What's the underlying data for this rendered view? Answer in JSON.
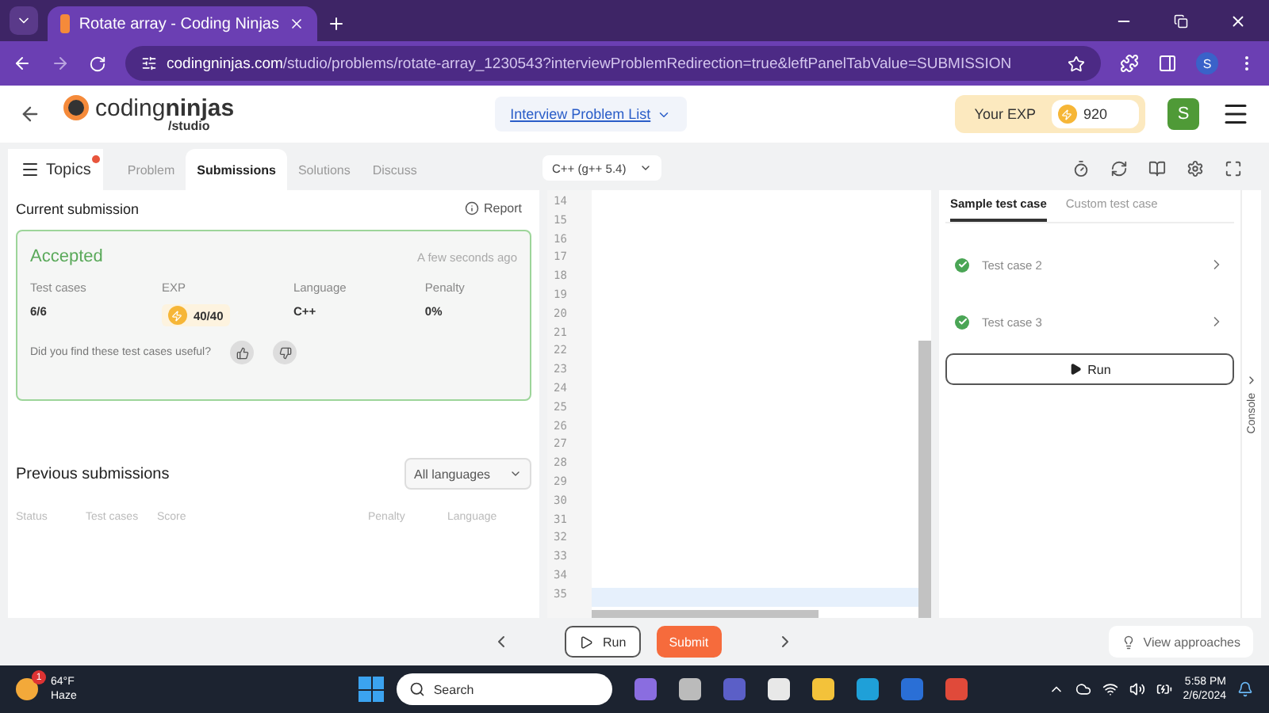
{
  "browser": {
    "tab_title": "Rotate array - Coding Ninjas",
    "url_host": "codingninjas.com",
    "url_path": "/studio/problems/rotate-array_1230543?interviewProblemRedirection=true&leftPanelTabValue=SUBMISSION",
    "profile": "S"
  },
  "header": {
    "logo_word_1": "coding",
    "logo_word_2": "ninjas",
    "logo_sub": "/studio",
    "nav_link": "Interview Problem List",
    "exp_label": "Your EXP",
    "exp_value": "920",
    "avatar": "S"
  },
  "left_tabs": {
    "topics": "Topics",
    "items": [
      {
        "label": "Problem",
        "selected": false
      },
      {
        "label": "Submissions",
        "selected": true
      },
      {
        "label": "Solutions",
        "selected": false
      },
      {
        "label": "Discuss",
        "selected": false
      }
    ]
  },
  "current_submission": {
    "title": "Current submission",
    "report": "Report",
    "status": "Accepted",
    "time": "A few seconds ago",
    "stats": [
      {
        "kind": "plain",
        "label": "Test cases",
        "value": "6/6"
      },
      {
        "kind": "exp",
        "label": "EXP",
        "value": "40/40"
      },
      {
        "kind": "plain",
        "label": "Language",
        "value": "C++"
      },
      {
        "kind": "plain",
        "label": "Penalty",
        "value": "0%"
      }
    ],
    "feedback": "Did you find these test cases useful?"
  },
  "previous_submissions": {
    "title": "Previous submissions",
    "filter": "All languages",
    "columns": [
      "Status",
      "Test cases",
      "Score",
      "Penalty",
      "Language"
    ]
  },
  "editor": {
    "language": "C++ (g++ 5.4)",
    "lines": [
      {
        "number": "14",
        "active": false
      },
      {
        "number": "15",
        "active": false
      },
      {
        "number": "16",
        "active": false
      },
      {
        "number": "17",
        "active": false
      },
      {
        "number": "18",
        "active": false
      },
      {
        "number": "19",
        "active": false
      },
      {
        "number": "20",
        "active": false
      },
      {
        "number": "21",
        "active": false
      },
      {
        "number": "22",
        "active": false
      },
      {
        "number": "23",
        "active": false
      },
      {
        "number": "24",
        "active": false
      },
      {
        "number": "25",
        "active": false
      },
      {
        "number": "26",
        "active": false
      },
      {
        "number": "27",
        "active": false
      },
      {
        "number": "28",
        "active": false
      },
      {
        "number": "29",
        "active": false
      },
      {
        "number": "30",
        "active": false
      },
      {
        "number": "31",
        "active": false
      },
      {
        "number": "32",
        "active": false
      },
      {
        "number": "33",
        "active": false
      },
      {
        "number": "34",
        "active": false
      },
      {
        "number": "35",
        "active": true
      }
    ]
  },
  "test_panel": {
    "tabs": [
      {
        "label": "Sample test case",
        "selected": true
      },
      {
        "label": "Custom test case",
        "selected": false
      }
    ],
    "cases": [
      {
        "label": "Test case 2",
        "passed": true
      },
      {
        "label": "Test case 3",
        "passed": true
      }
    ],
    "run": "Run",
    "console": "Console"
  },
  "bottom_bar": {
    "run": "Run",
    "submit": "Submit",
    "view_approaches": "View approaches"
  },
  "taskbar": {
    "temperature": "64°F",
    "weather": "Haze",
    "weather_badge": "1",
    "search": "Search",
    "time": "5:58 PM",
    "date": "2/6/2024"
  }
}
